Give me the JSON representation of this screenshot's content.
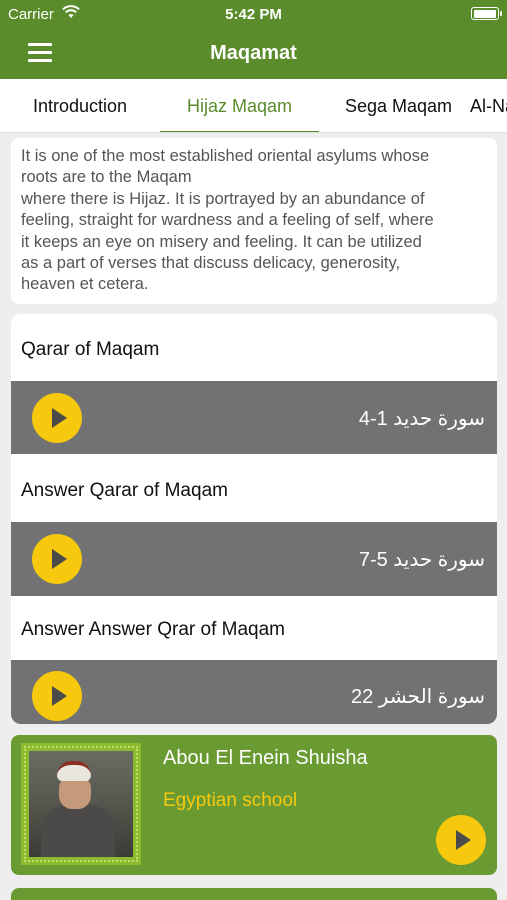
{
  "status_bar": {
    "carrier": "Carrier",
    "time": "5:42 PM",
    "battery_level": 1.0
  },
  "nav": {
    "title": "Maqamat",
    "menu_icon": "hamburger-menu-icon"
  },
  "tabs": [
    {
      "label": "Introduction",
      "active": false
    },
    {
      "label": "Hijaz Maqam",
      "active": true
    },
    {
      "label": "Sega Maqam",
      "active": false
    },
    {
      "label": "Al-Nahawand Maqam",
      "active": false
    }
  ],
  "intro": {
    "lines": [
      "It is one of the most established oriental asylums whose",
      "roots are to the Maqam",
      "where there is Hijaz. It is portrayed by an abundance of",
      "feeling, straight for wardness and a feeling of self, where",
      "it keeps an eye on misery and feeling. It can be utilized",
      "as a part of verses that discuss delicacy, generosity,",
      "heaven et cetera."
    ]
  },
  "recitations": [
    {
      "title": "Qarar of Maqam",
      "surah": "سورة حديد 1-4"
    },
    {
      "title": "Answer Qarar of Maqam",
      "surah": "سورة حديد 5-7"
    },
    {
      "title": "Answer Answer Qrar of Maqam",
      "surah": "سورة الحشر 22"
    }
  ],
  "reciter": {
    "name": "Abou El Enein Shuisha",
    "school": "Egyptian school"
  },
  "colors": {
    "primary": "#5a8c2b",
    "card_green": "#6a9a32",
    "accent": "#f6c90e",
    "player_bar": "#727275"
  }
}
